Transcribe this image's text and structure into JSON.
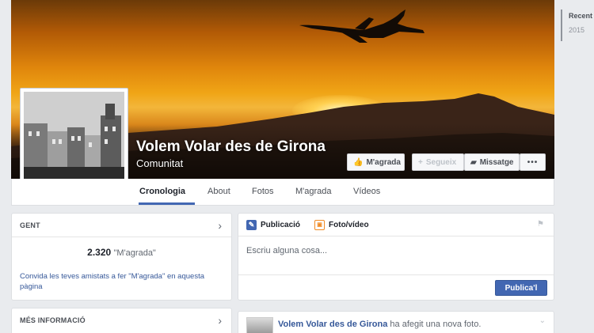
{
  "page": {
    "name": "Volem Volar des de Girona",
    "category": "Comunitat"
  },
  "cover_actions": {
    "like": "M'agrada",
    "follow": "Segueix",
    "message": "Missatge",
    "more": "•••"
  },
  "tabs": [
    {
      "label": "Cronologia",
      "active": true
    },
    {
      "label": "About"
    },
    {
      "label": "Fotos"
    },
    {
      "label": "M'agrada"
    },
    {
      "label": "Vídeos"
    }
  ],
  "rail": {
    "recent": "Recent",
    "year": "2015"
  },
  "people_card": {
    "title": "GENT",
    "likes_count": "2.320",
    "likes_label": "\"M'agrada\"",
    "invite": "Convida les teves amistats a fer \"M'agrada\" en aquesta pàgina"
  },
  "info_card": {
    "title": "MÉS INFORMACIÓ"
  },
  "composer": {
    "tab_post": "Publicació",
    "tab_photo": "Foto/vídeo",
    "placeholder": "Escriu alguna cosa...",
    "submit": "Publica'l"
  },
  "story": {
    "author": "Volem Volar des de Girona",
    "action": " ha afegit una nova foto."
  },
  "colors": {
    "accent": "#4267b2",
    "link": "#365899",
    "background": "#e9ebee"
  }
}
